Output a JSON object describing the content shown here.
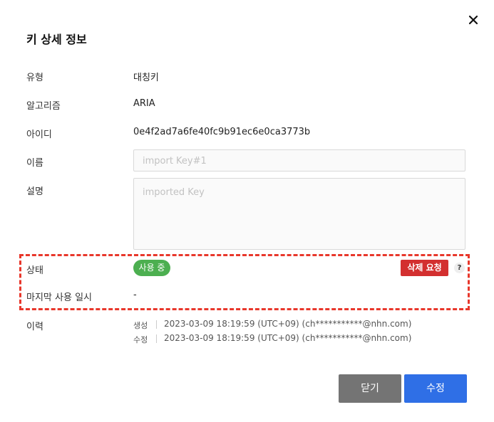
{
  "dialog": {
    "title": "키 상세 정보"
  },
  "fields": {
    "type": {
      "label": "유형",
      "value": "대칭키"
    },
    "algorithm": {
      "label": "알고리즘",
      "value": "ARIA"
    },
    "id": {
      "label": "아이디",
      "value": "0e4f2ad7a6fe40fc9b91ec6e0ca3773b"
    },
    "name": {
      "label": "이름",
      "placeholder": "import Key#1"
    },
    "description": {
      "label": "설명",
      "placeholder": "imported Key"
    },
    "status": {
      "label": "상태",
      "value": "사용 중",
      "delete_label": "삭제 요청",
      "help": "?"
    },
    "last_used": {
      "label": "마지막 사용 일시",
      "value": "-"
    },
    "history": {
      "label": "이력",
      "created_label": "생성",
      "created_value": "2023-03-09 18:19:59 (UTC+09) (ch***********@nhn.com)",
      "modified_label": "수정",
      "modified_value": "2023-03-09 18:19:59 (UTC+09) (ch***********@nhn.com)"
    }
  },
  "footer": {
    "close_label": "닫기",
    "edit_label": "수정"
  },
  "colors": {
    "status_active": "#4caf50",
    "danger": "#d32f2f",
    "primary": "#2f6fe6",
    "secondary": "#747474",
    "highlight": "#e8372b"
  }
}
